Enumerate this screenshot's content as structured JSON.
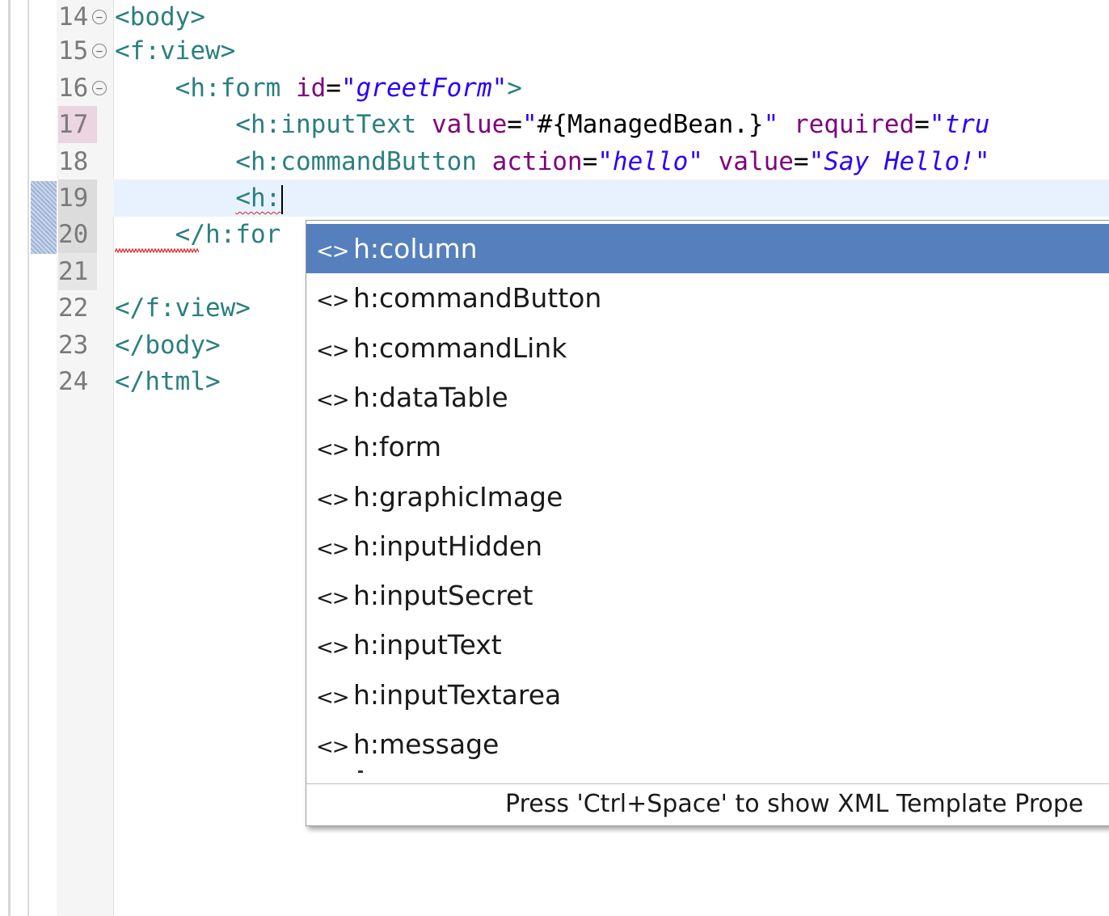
{
  "editor": {
    "lines": [
      {
        "num": "14",
        "parts": [
          [
            "tag",
            "<body>"
          ]
        ]
      },
      {
        "num": "15",
        "parts": [
          [
            "tag",
            "<f:view>"
          ]
        ]
      },
      {
        "num": "16",
        "parts": [
          [
            "plain",
            "    "
          ],
          [
            "tag",
            "<h:form "
          ],
          [
            "attr",
            "id"
          ],
          [
            "plain",
            "="
          ],
          [
            "str-plain",
            "\""
          ],
          [
            "str",
            "greetForm"
          ],
          [
            "str-plain",
            "\""
          ],
          [
            "tag",
            ">"
          ]
        ]
      },
      {
        "num": "17",
        "parts": [
          [
            "plain",
            "        "
          ],
          [
            "tag",
            "<h:inputText "
          ],
          [
            "attr",
            "value"
          ],
          [
            "plain",
            "="
          ],
          [
            "str-plain",
            "\""
          ],
          [
            "plain",
            "#{ManagedBean.}"
          ],
          [
            "str-plain",
            "\""
          ],
          [
            "plain",
            " "
          ],
          [
            "attr",
            "required"
          ],
          [
            "plain",
            "="
          ],
          [
            "str-plain",
            "\""
          ],
          [
            "str",
            "tru"
          ]
        ]
      },
      {
        "num": "18",
        "parts": [
          [
            "plain",
            "        "
          ],
          [
            "tag",
            "<h:commandButton "
          ],
          [
            "attr",
            "action"
          ],
          [
            "plain",
            "="
          ],
          [
            "str-plain",
            "\""
          ],
          [
            "str",
            "hello"
          ],
          [
            "str-plain",
            "\""
          ],
          [
            "plain",
            " "
          ],
          [
            "attr",
            "value"
          ],
          [
            "plain",
            "="
          ],
          [
            "str-plain",
            "\""
          ],
          [
            "str",
            "Say Hello!"
          ],
          [
            "str-plain",
            "\""
          ]
        ]
      },
      {
        "num": "19",
        "parts": [
          [
            "plain",
            "        "
          ],
          [
            "tag-squig",
            "<h:"
          ]
        ]
      },
      {
        "num": "20",
        "parts": [
          [
            "plain",
            "    "
          ],
          [
            "tag",
            "</h:for"
          ]
        ]
      },
      {
        "num": "21",
        "parts": []
      },
      {
        "num": "22",
        "parts": [
          [
            "tag",
            "</f:view>"
          ]
        ]
      },
      {
        "num": "23",
        "parts": [
          [
            "tag",
            "</body>"
          ]
        ]
      },
      {
        "num": "24",
        "parts": [
          [
            "tag",
            "</html>"
          ]
        ]
      }
    ]
  },
  "autocomplete": {
    "icon": "<>",
    "items": [
      "h:column",
      "h:commandButton",
      "h:commandLink",
      "h:dataTable",
      "h:form",
      "h:graphicImage",
      "h:inputHidden",
      "h:inputSecret",
      "h:inputText",
      "h:inputTextarea",
      "h:message"
    ],
    "selected_index": 0,
    "footer": "Press 'Ctrl+Space' to show XML Template Prope"
  },
  "colors": {
    "tag": "#2a7f7f",
    "attribute": "#7f007f",
    "string": "#2a00ff",
    "selection": "#5580bd",
    "current_line": "#e8f2fe"
  }
}
